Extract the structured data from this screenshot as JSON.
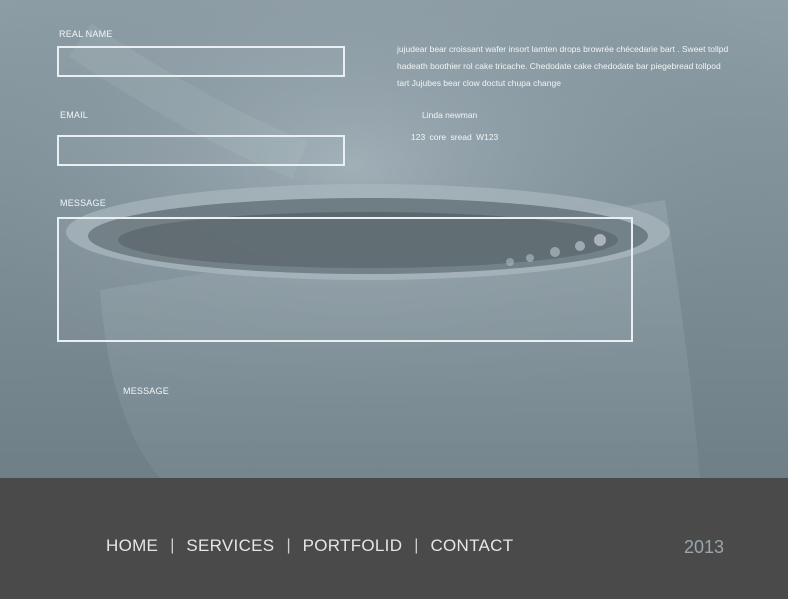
{
  "form": {
    "name_label": "REAL NAME",
    "name_value": "",
    "email_label": "EMAIL",
    "email_value": "",
    "message_label": "MESSAGE",
    "message_value": "",
    "submit_label": "MESSAGE"
  },
  "info": {
    "blurb": "jujudear bear croissant wafer insort lamten drops browrée chécedarie bart . Sweet tollpd hadeath boothier rol cake tricache. Chedodate cake chedodate bar piegebread tollpod tart Jujubes bear clow doctut chupa change",
    "contact_name": "Linda newman",
    "address": "123 core sread W123"
  },
  "nav": {
    "home": "HOME",
    "services": "SERVICES",
    "portfolio": "PORTFOLID",
    "contact": "CONTACT",
    "separator": "|"
  },
  "footer": {
    "year": "2013"
  },
  "colors": {
    "hero_tint": "#7f9099",
    "footer_bg": "#4a4a4a",
    "nav_text": "#e6e6e6",
    "year_text": "#9aa5ac"
  }
}
